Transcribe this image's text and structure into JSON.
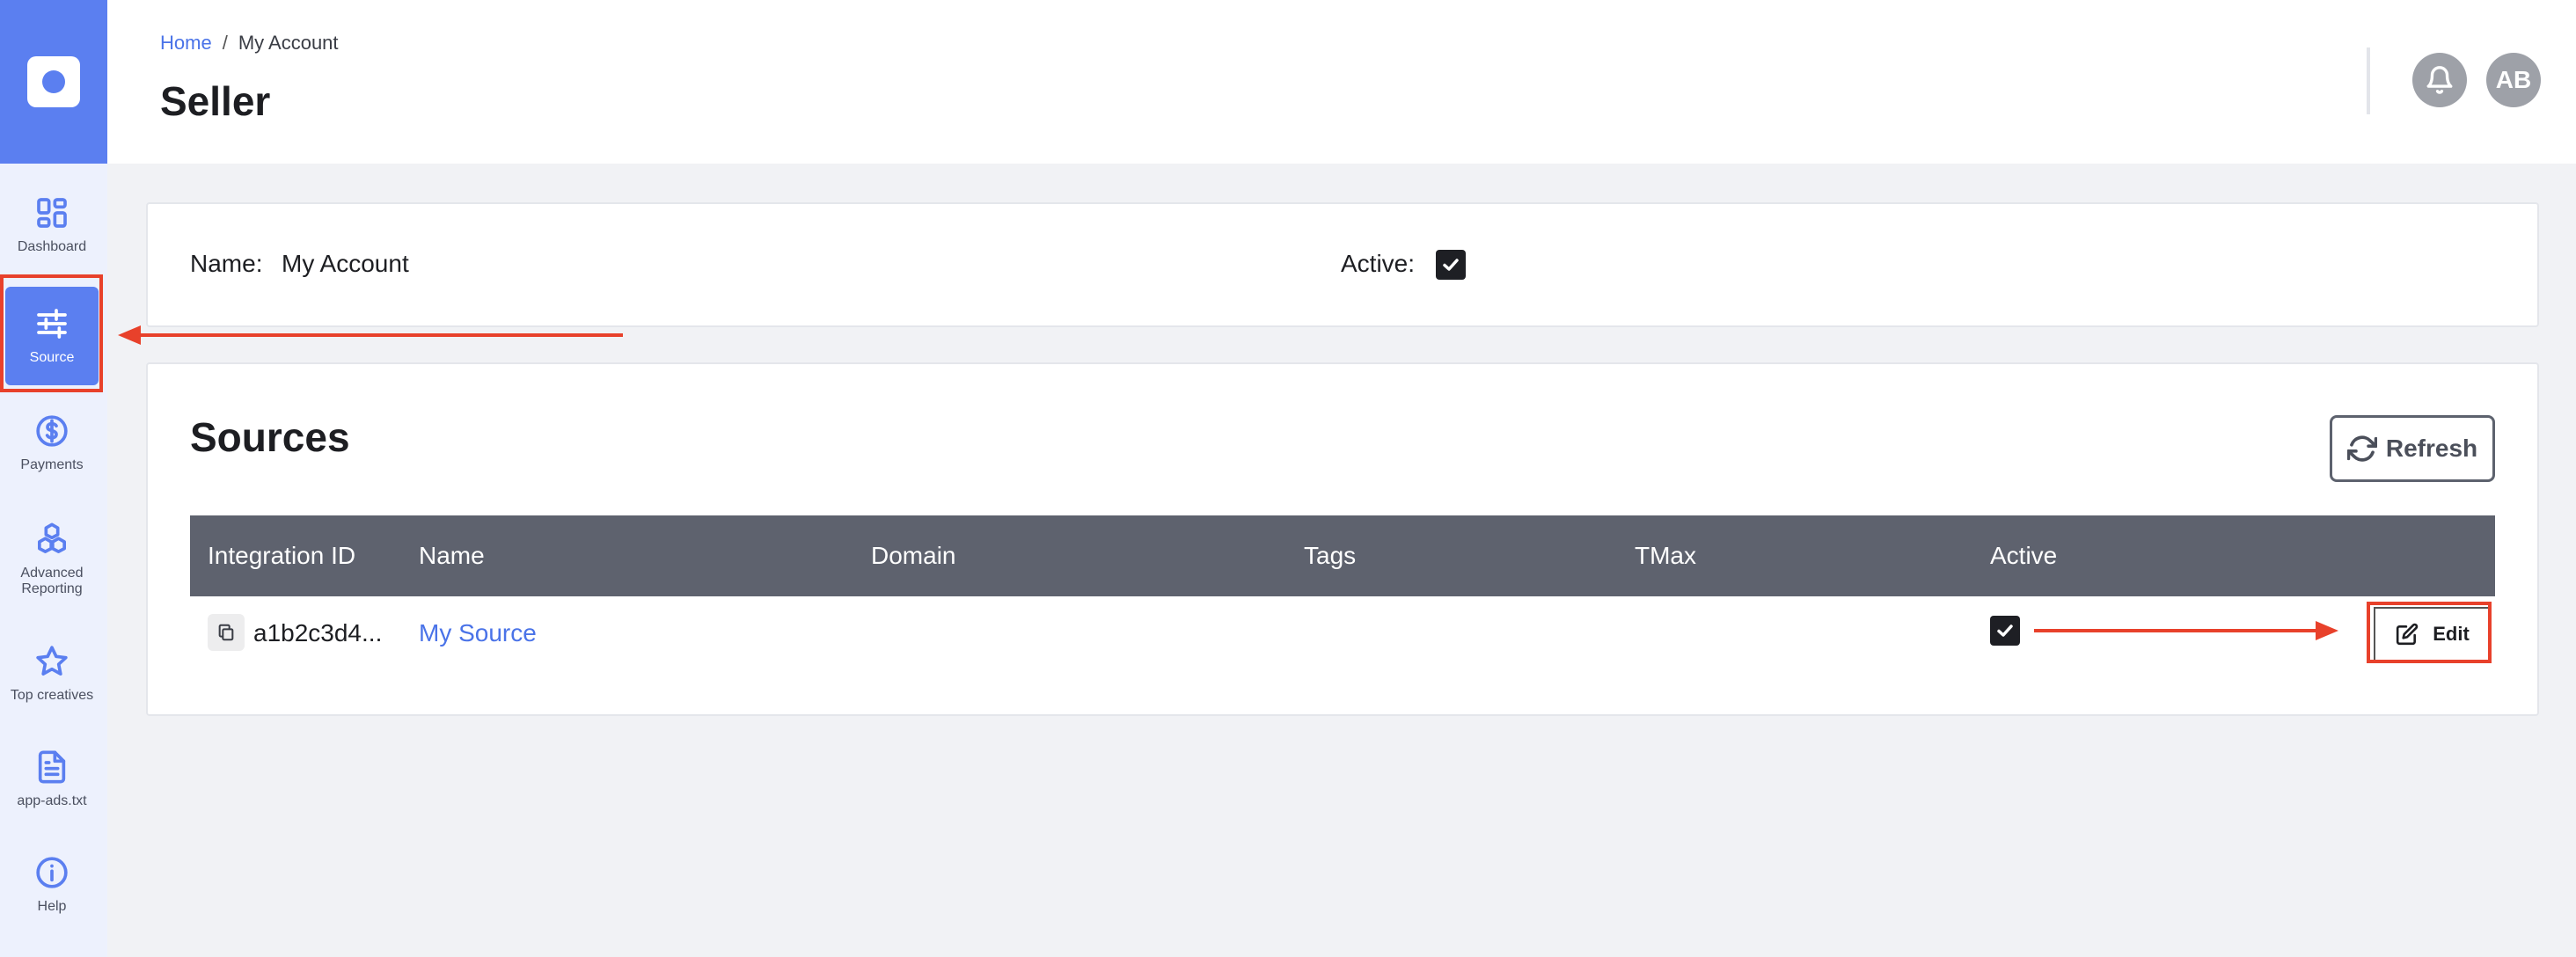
{
  "sidebar": {
    "items": [
      {
        "label": "Dashboard",
        "icon": "dashboard-icon"
      },
      {
        "label": "Source",
        "icon": "sliders-icon"
      },
      {
        "label": "Payments",
        "icon": "dollar-icon"
      },
      {
        "label": "Advanced Reporting",
        "icon": "cubes-icon"
      },
      {
        "label": "Top creatives",
        "icon": "star-icon"
      },
      {
        "label": "app-ads.txt",
        "icon": "file-text-icon"
      },
      {
        "label": "Help",
        "icon": "info-icon"
      }
    ],
    "active": "Source"
  },
  "header": {
    "breadcrumb": {
      "home": "Home",
      "separator": "/",
      "current": "My Account"
    },
    "title": "Seller",
    "avatar_initials": "AB"
  },
  "account": {
    "name_label": "Name:",
    "name_value": "My Account",
    "active_label": "Active:",
    "active": true
  },
  "sources": {
    "title": "Sources",
    "refresh_label": "Refresh",
    "columns": [
      "Integration ID",
      "Name",
      "Domain",
      "Tags",
      "TMax",
      "Active"
    ],
    "rows": [
      {
        "integration_id": "a1b2c3d4...",
        "name": "My Source",
        "domain": "",
        "tags": "",
        "tmax": "",
        "active": true,
        "edit_label": "Edit"
      }
    ]
  },
  "colors": {
    "accent": "#5b7ff0",
    "link": "#4a73e8",
    "annotation": "#e8412b",
    "table_header": "#5e626e"
  }
}
